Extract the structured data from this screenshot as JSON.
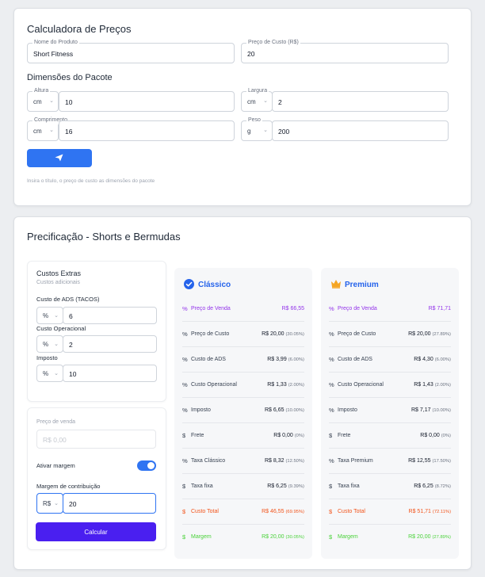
{
  "calculator": {
    "title": "Calculadora de Preços",
    "product_name_label": "Nome do Produto",
    "product_name_value": "Short Fitness",
    "cost_price_label": "Preço de Custo (R$)",
    "cost_price_value": "20",
    "dimensions_title": "Dimensões do Pacote",
    "height_label": "Altura",
    "height_unit": "cm",
    "height_value": "10",
    "width_label": "Largura",
    "width_unit": "cm",
    "width_value": "2",
    "length_label": "Comprimento",
    "length_unit": "cm",
    "length_value": "16",
    "weight_label": "Peso",
    "weight_unit": "g",
    "weight_value": "200",
    "hint": "Insira o título, o preço de custo as dimensões do pacote",
    "send_icon": "send-icon"
  },
  "pricing": {
    "title": "Precificação - Shorts e Bermudas",
    "extras": {
      "title": "Custos Extras",
      "subtitle": "Custos adicionais",
      "ads_label": "Custo de ADS (TACOS)",
      "ads_unit": "%",
      "ads_value": "6",
      "operational_label": "Custo Operacional",
      "operational_unit": "%",
      "operational_value": "2",
      "tax_label": "Imposto",
      "tax_unit": "%",
      "tax_value": "10"
    },
    "sale": {
      "sale_price_label": "Preço de venda",
      "sale_price_placeholder": "R$ 0,00",
      "margin_toggle_label": "Ativar margem",
      "margin_toggle_on": true,
      "margin_label": "Margem de contribuição",
      "margin_unit": "R$",
      "margin_value": "20",
      "calculate_label": "Calcular"
    },
    "plans": [
      {
        "name": "Clássico",
        "icon": "check-circle-icon",
        "color": "#2563eb",
        "rows": [
          {
            "icon": "%",
            "label": "Preço de Venda",
            "value": "R$ 66,55",
            "pct": "",
            "style": "purple"
          },
          {
            "icon": "%",
            "label": "Preço de Custo",
            "value": "R$ 20,00",
            "pct": "(30.05%)",
            "style": ""
          },
          {
            "icon": "%",
            "label": "Custo de ADS",
            "value": "R$ 3,99",
            "pct": "(6.00%)",
            "style": ""
          },
          {
            "icon": "%",
            "label": "Custo Operacional",
            "value": "R$ 1,33",
            "pct": "(2.00%)",
            "style": ""
          },
          {
            "icon": "%",
            "label": "Imposto",
            "value": "R$ 6,65",
            "pct": "(10.00%)",
            "style": ""
          },
          {
            "icon": "$",
            "label": "Frete",
            "value": "R$ 0,00",
            "pct": "(0%)",
            "style": ""
          },
          {
            "icon": "%",
            "label": "Taxa Clássico",
            "value": "R$ 8,32",
            "pct": "(12.50%)",
            "style": ""
          },
          {
            "icon": "$",
            "label": "Taxa fixa",
            "value": "R$ 6,25",
            "pct": "(9.39%)",
            "style": ""
          },
          {
            "icon": "$",
            "label": "Custo Total",
            "value": "R$ 46,55",
            "pct": "(69.95%)",
            "style": "red"
          },
          {
            "icon": "$",
            "label": "Margem",
            "value": "R$ 20,00",
            "pct": "(30.05%)",
            "style": "green"
          }
        ]
      },
      {
        "name": "Premium",
        "icon": "crown-icon",
        "color": "#2563eb",
        "rows": [
          {
            "icon": "%",
            "label": "Preço de Venda",
            "value": "R$ 71,71",
            "pct": "",
            "style": "purple"
          },
          {
            "icon": "%",
            "label": "Preço de Custo",
            "value": "R$ 20,00",
            "pct": "(27.89%)",
            "style": ""
          },
          {
            "icon": "%",
            "label": "Custo de ADS",
            "value": "R$ 4,30",
            "pct": "(6.00%)",
            "style": ""
          },
          {
            "icon": "%",
            "label": "Custo Operacional",
            "value": "R$ 1,43",
            "pct": "(2.00%)",
            "style": ""
          },
          {
            "icon": "%",
            "label": "Imposto",
            "value": "R$ 7,17",
            "pct": "(10.00%)",
            "style": ""
          },
          {
            "icon": "$",
            "label": "Frete",
            "value": "R$ 0,00",
            "pct": "(0%)",
            "style": ""
          },
          {
            "icon": "%",
            "label": "Taxa Premium",
            "value": "R$ 12,55",
            "pct": "(17.50%)",
            "style": ""
          },
          {
            "icon": "$",
            "label": "Taxa fixa",
            "value": "R$ 6,25",
            "pct": "(8.72%)",
            "style": ""
          },
          {
            "icon": "$",
            "label": "Custo Total",
            "value": "R$ 51,71",
            "pct": "(72.11%)",
            "style": "red"
          },
          {
            "icon": "$",
            "label": "Margem",
            "value": "R$ 20,00",
            "pct": "(27.89%)",
            "style": "green"
          }
        ]
      }
    ]
  },
  "colors": {
    "accent_blue": "#2f74f2",
    "calculate_purple": "#4a1ff0",
    "sale_purple": "#9333ea",
    "total_red": "#f2541b",
    "margin_green": "#4ad23a",
    "crown_gold": "#f5a623"
  }
}
